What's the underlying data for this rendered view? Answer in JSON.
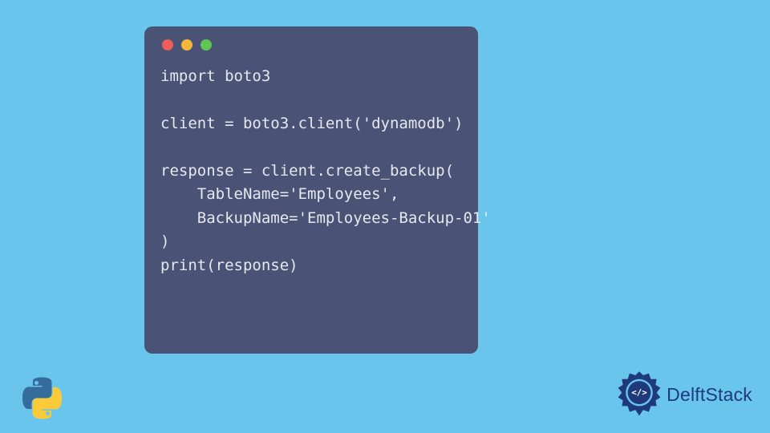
{
  "code": {
    "lines": [
      "import boto3",
      "",
      "client = boto3.client('dynamodb')",
      "",
      "response = client.create_backup(",
      "    TableName='Employees',",
      "    BackupName='Employees-Backup-01'",
      ")",
      "print(response)"
    ]
  },
  "brand": {
    "name": "DelftStack"
  },
  "colors": {
    "bg": "#6ac5ed",
    "window": "#4a5275",
    "code_fg": "#e6e8ef",
    "dot_red": "#ec5e57",
    "dot_yellow": "#f4b63c",
    "dot_green": "#5ec754",
    "brand_text": "#1e3a7b"
  }
}
